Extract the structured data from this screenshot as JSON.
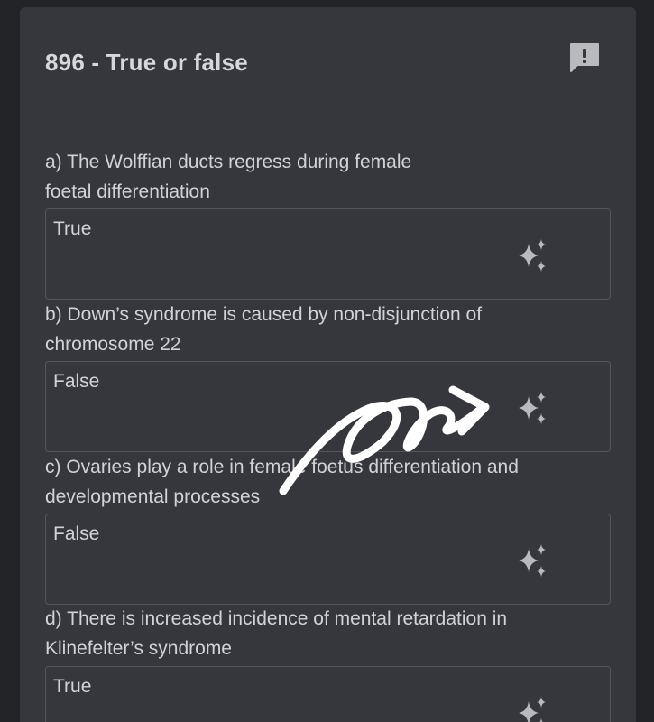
{
  "card": {
    "title": "896 - True or false",
    "report_icon": "report-icon"
  },
  "questions": [
    {
      "line1": "a) The Wolffian ducts regress during female",
      "line2": "foetal differentiation",
      "answer": "True",
      "sparkle_icon": "sparkle-icon"
    },
    {
      "line1": "b) Down’s syndrome is caused by non-disjunction of",
      "line2": "chromosome 22",
      "answer": "False",
      "sparkle_icon": "sparkle-icon"
    },
    {
      "line1": "c) Ovaries play a role in female foetus differentiation and",
      "line2": "developmental processes",
      "answer": "False",
      "sparkle_icon": "sparkle-icon"
    },
    {
      "line1": "d) There is increased incidence of mental retardation in",
      "line2": "Klinefelter’s syndrome",
      "answer": "True",
      "sparkle_icon": "sparkle-icon"
    }
  ],
  "colors": {
    "page_bg": "#232428",
    "card_bg": "#36373d",
    "text": "#d2d3d6",
    "icon": "#b9babe",
    "box_border": "#55565c",
    "annotation": "#ffffff"
  }
}
